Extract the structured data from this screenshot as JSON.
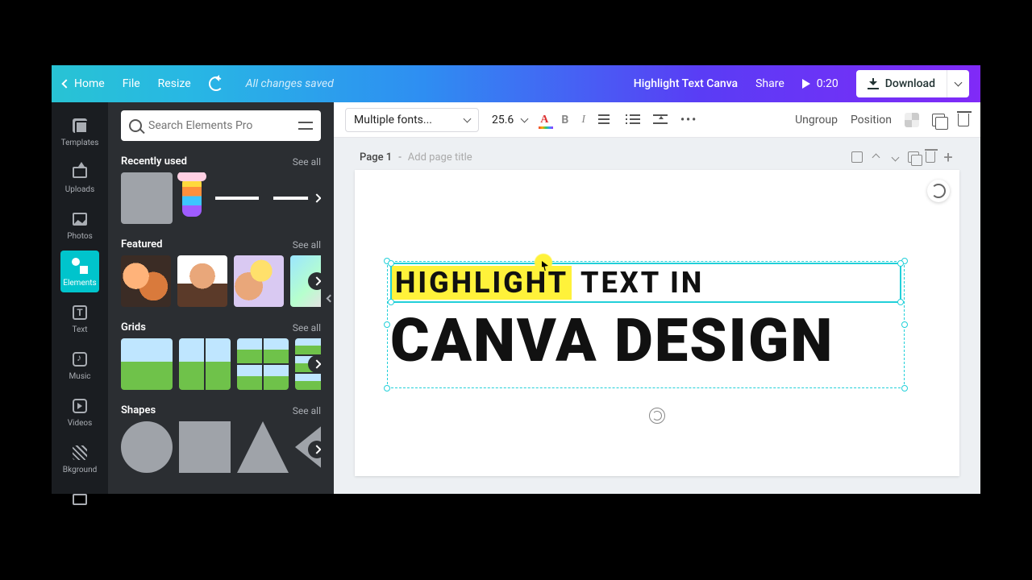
{
  "topnav": {
    "home": "Home",
    "file": "File",
    "resize": "Resize",
    "saved_msg": "All changes saved",
    "doc_title": "Highlight Text Canva",
    "share": "Share",
    "timecode": "0:20",
    "download": "Download"
  },
  "rail": {
    "templates": "Templates",
    "uploads": "Uploads",
    "photos": "Photos",
    "elements": "Elements",
    "text": "Text",
    "music": "Music",
    "videos": "Videos",
    "background": "Bkground"
  },
  "sidebar": {
    "search_placeholder": "Search Elements Pro",
    "sections": {
      "recent": {
        "title": "Recently used",
        "see": "See all"
      },
      "featured": {
        "title": "Featured",
        "see": "See all"
      },
      "grids": {
        "title": "Grids",
        "see": "See all"
      },
      "shapes": {
        "title": "Shapes",
        "see": "See all"
      }
    }
  },
  "toolbar": {
    "font": "Multiple fonts...",
    "size": "25.6",
    "ungroup": "Ungroup",
    "position": "Position"
  },
  "pagebar": {
    "page_label": "Page 1",
    "dash": " - ",
    "title_placeholder": "Add page title"
  },
  "canvas": {
    "highlight_word": "HIGHLIGHT",
    "rest_line1": " TEXT IN",
    "line2": "CANVA DESIGN"
  }
}
